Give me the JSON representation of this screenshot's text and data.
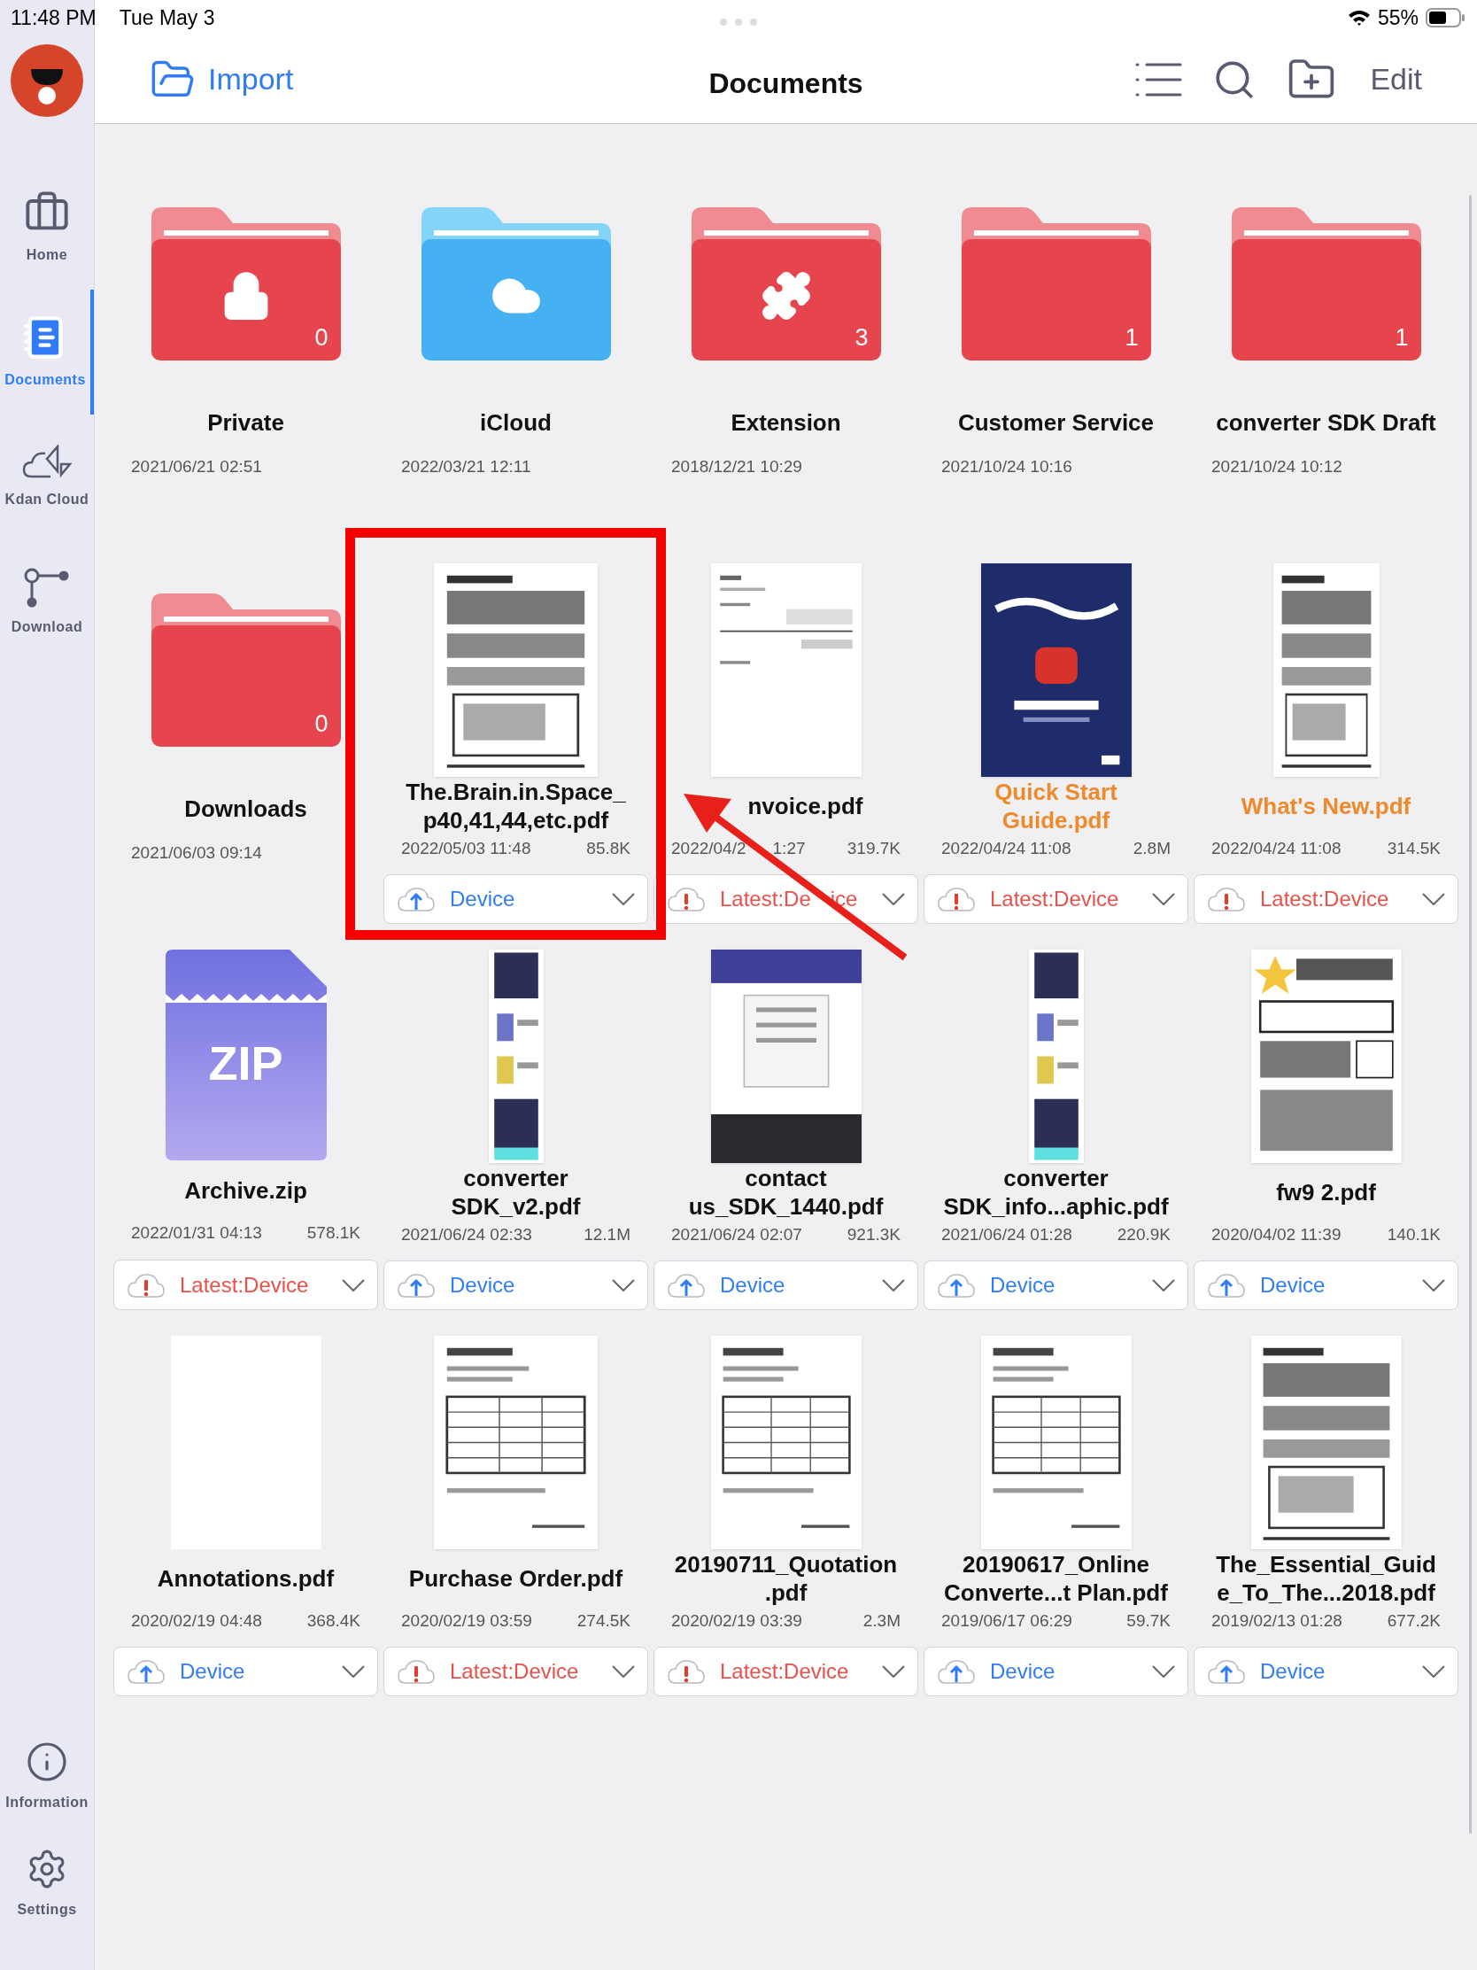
{
  "status_bar": {
    "time": "11:48 PM",
    "date": "Tue May 3",
    "battery_text": "55%"
  },
  "sidebar": {
    "items": [
      {
        "label": "Home",
        "selected": false
      },
      {
        "label": "Documents",
        "selected": true
      },
      {
        "label": "Kdan Cloud",
        "selected": false
      },
      {
        "label": "Download",
        "selected": false
      }
    ],
    "bottom_items": [
      {
        "label": "Information",
        "selected": false
      },
      {
        "label": "Settings",
        "selected": false
      }
    ]
  },
  "toolbar": {
    "import_label": "Import",
    "title": "Documents",
    "edit_label": "Edit"
  },
  "files": [
    {
      "name": [
        "Private"
      ],
      "highlighted": false,
      "date": "2021/06/21 02:51",
      "thumb": {
        "kind": "folder",
        "color": "#e6454e",
        "count": "0"
      }
    },
    {
      "name": [
        "iCloud"
      ],
      "highlighted": false,
      "date": "2022/03/21 12:11",
      "thumb": {
        "kind": "folder",
        "color": "#45b1f2"
      }
    },
    {
      "name": [
        "Extension"
      ],
      "highlighted": false,
      "date": "2018/12/21 10:29",
      "thumb": {
        "kind": "folder",
        "color": "#e6454e",
        "count": "3"
      }
    },
    {
      "name": [
        "Customer Service"
      ],
      "highlighted": false,
      "date": "2021/10/24 10:16",
      "thumb": {
        "kind": "folder",
        "color": "#e6454e",
        "count": "1"
      }
    },
    {
      "name": [
        "converter SDK Draft"
      ],
      "highlighted": false,
      "date": "2021/10/24 10:12",
      "thumb": {
        "kind": "folder",
        "color": "#e6454e",
        "count": "1"
      }
    },
    {
      "name": [
        "Downloads"
      ],
      "highlighted": false,
      "date": "2021/06/03 09:14",
      "thumb": {
        "kind": "folder",
        "color": "#e6454e",
        "count": "0"
      }
    },
    {
      "name": [
        "The.Brain.in.Space_",
        "p40,41,44,etc.pdf"
      ],
      "highlighted": false,
      "date": "2022/05/03 11:48",
      "size": "85.8K",
      "thumb": {
        "kind": "picture"
      },
      "sync": {
        "kind": "uploaded",
        "label": "Device"
      }
    },
    {
      "name": [
        "nvoice.pdf"
      ],
      "highlighted": false,
      "date": "2022/04/2",
      "date_rest": "1:27",
      "size": "319.7K",
      "thumb": {
        "kind": "picture"
      },
      "sync": {
        "kind": "conflict",
        "label": "Latest:De",
        "label_rest": "ice"
      }
    },
    {
      "name": [
        "Quick Start",
        "Guide.pdf"
      ],
      "highlighted": true,
      "date": "2022/04/24 11:08",
      "size": "2.8M",
      "thumb": {
        "kind": "picture"
      },
      "sync": {
        "kind": "conflict",
        "label": "Latest:Device"
      }
    },
    {
      "name": [
        "What's New.pdf"
      ],
      "highlighted": true,
      "date": "2022/04/24 11:08",
      "size": "314.5K",
      "thumb": {
        "kind": "picture"
      },
      "sync": {
        "kind": "conflict",
        "label": "Latest:Device"
      }
    },
    {
      "name": [
        "Archive.zip"
      ],
      "highlighted": false,
      "date": "2022/01/31 04:13",
      "size": "578.1K",
      "thumb": {
        "kind": "zip",
        "label": "ZIP"
      },
      "sync": {
        "kind": "conflict",
        "label": "Latest:Device"
      }
    },
    {
      "name": [
        "converter",
        "SDK_v2.pdf"
      ],
      "highlighted": false,
      "date": "2021/06/24 02:33",
      "size": "12.1M",
      "thumb": {
        "kind": "picture"
      },
      "sync": {
        "kind": "uploaded",
        "label": "Device"
      }
    },
    {
      "name": [
        "contact",
        "us_SDK_1440.pdf"
      ],
      "highlighted": false,
      "date": "2021/06/24 02:07",
      "size": "921.3K",
      "thumb": {
        "kind": "picture"
      },
      "sync": {
        "kind": "uploaded",
        "label": "Device"
      }
    },
    {
      "name": [
        "converter",
        "SDK_info...aphic.pdf"
      ],
      "highlighted": false,
      "date": "2021/06/24 01:28",
      "size": "220.9K",
      "thumb": {
        "kind": "picture"
      },
      "sync": {
        "kind": "uploaded",
        "label": "Device"
      }
    },
    {
      "name": [
        "fw9 2.pdf"
      ],
      "highlighted": false,
      "date": "2020/04/02 11:39",
      "size": "140.1K",
      "thumb": {
        "kind": "picture"
      },
      "sync": {
        "kind": "uploaded",
        "label": "Device"
      }
    },
    {
      "name": [
        "Annotations.pdf"
      ],
      "highlighted": false,
      "date": "2020/02/19 04:48",
      "size": "368.4K",
      "thumb": {
        "kind": "blank"
      },
      "sync": {
        "kind": "uploaded",
        "label": "Device"
      }
    },
    {
      "name": [
        "Purchase Order.pdf"
      ],
      "highlighted": false,
      "date": "2020/02/19 03:59",
      "size": "274.5K",
      "thumb": {
        "kind": "picture"
      },
      "sync": {
        "kind": "conflict",
        "label": "Latest:Device"
      }
    },
    {
      "name": [
        "20190711_Quotation",
        ".pdf"
      ],
      "highlighted": false,
      "date": "2020/02/19 03:39",
      "size": "2.3M",
      "thumb": {
        "kind": "picture"
      },
      "sync": {
        "kind": "conflict",
        "label": "Latest:Device"
      }
    },
    {
      "name": [
        "20190617_Online",
        "Converte...t Plan.pdf"
      ],
      "highlighted": false,
      "date": "2019/06/17 06:29",
      "size": "59.7K",
      "thumb": {
        "kind": "picture"
      },
      "sync": {
        "kind": "uploaded",
        "label": "Device"
      }
    },
    {
      "name": [
        "The_Essential_Guid",
        "e_To_The...2018.pdf"
      ],
      "highlighted": false,
      "date": "2019/02/13 01:28",
      "size": "677.2K",
      "thumb": {
        "kind": "picture"
      },
      "sync": {
        "kind": "uploaded",
        "label": "Device"
      }
    }
  ]
}
